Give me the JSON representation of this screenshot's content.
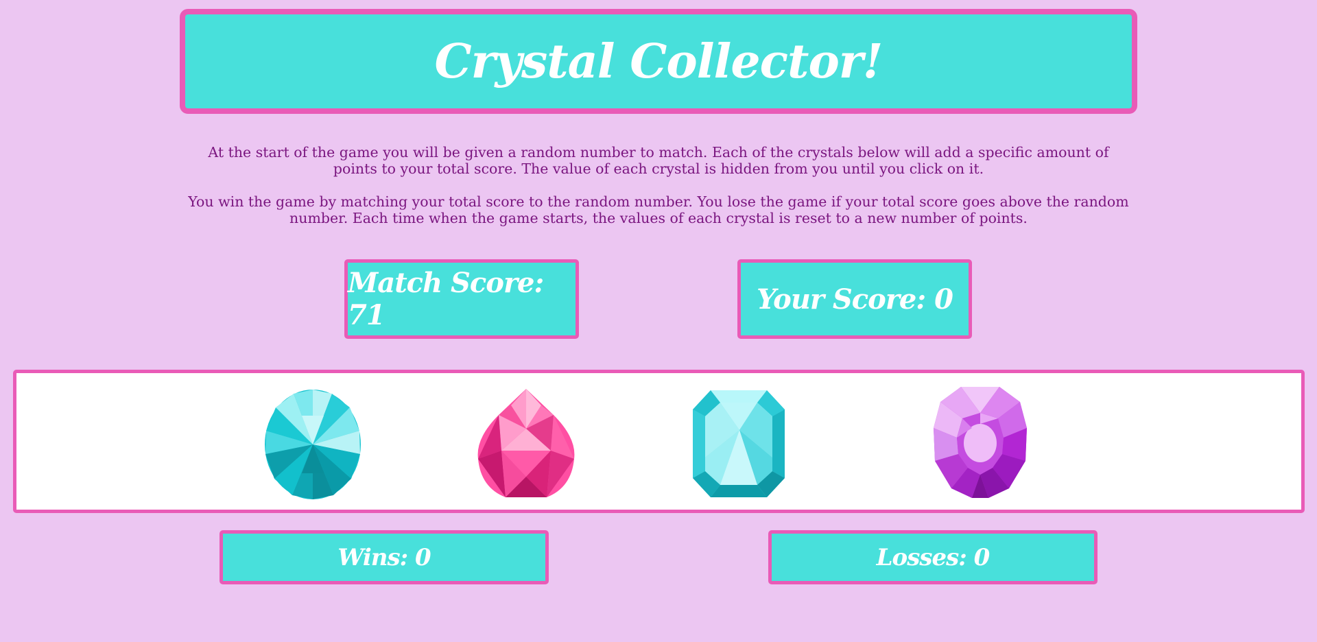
{
  "header": {
    "title": "Crystal Collector!"
  },
  "instructions": {
    "paragraph_1": "At the start of the game you will be given a random number to match. Each of the crystals below will add a specific amount of points to your total score. The value of each crystal is hidden from you until you click on it.",
    "paragraph_2": "You win the game by matching your total score to the random number. You lose the game if your total score goes above the random number. Each time when the game starts, the values of each crystal is reset to a new number of points."
  },
  "scores": {
    "match_label": "Match Score: ",
    "match_value": "71",
    "your_label": "Your Score: ",
    "your_value": "0"
  },
  "crystals": [
    {
      "name": "teal-oval-crystal",
      "color": "#1bc9d3"
    },
    {
      "name": "pink-pear-crystal",
      "color": "#ff4fa3"
    },
    {
      "name": "aqua-emerald-crystal",
      "color": "#5fe3ea"
    },
    {
      "name": "purple-round-crystal",
      "color": "#c53be0"
    }
  ],
  "stats": {
    "wins_label": "Wins: ",
    "wins_value": "0",
    "losses_label": "Losses: ",
    "losses_value": "0"
  },
  "colors": {
    "background": "#ecc6f2",
    "box_fill": "#48e0db",
    "border": "#e95bb7",
    "text": "#7a157f"
  }
}
